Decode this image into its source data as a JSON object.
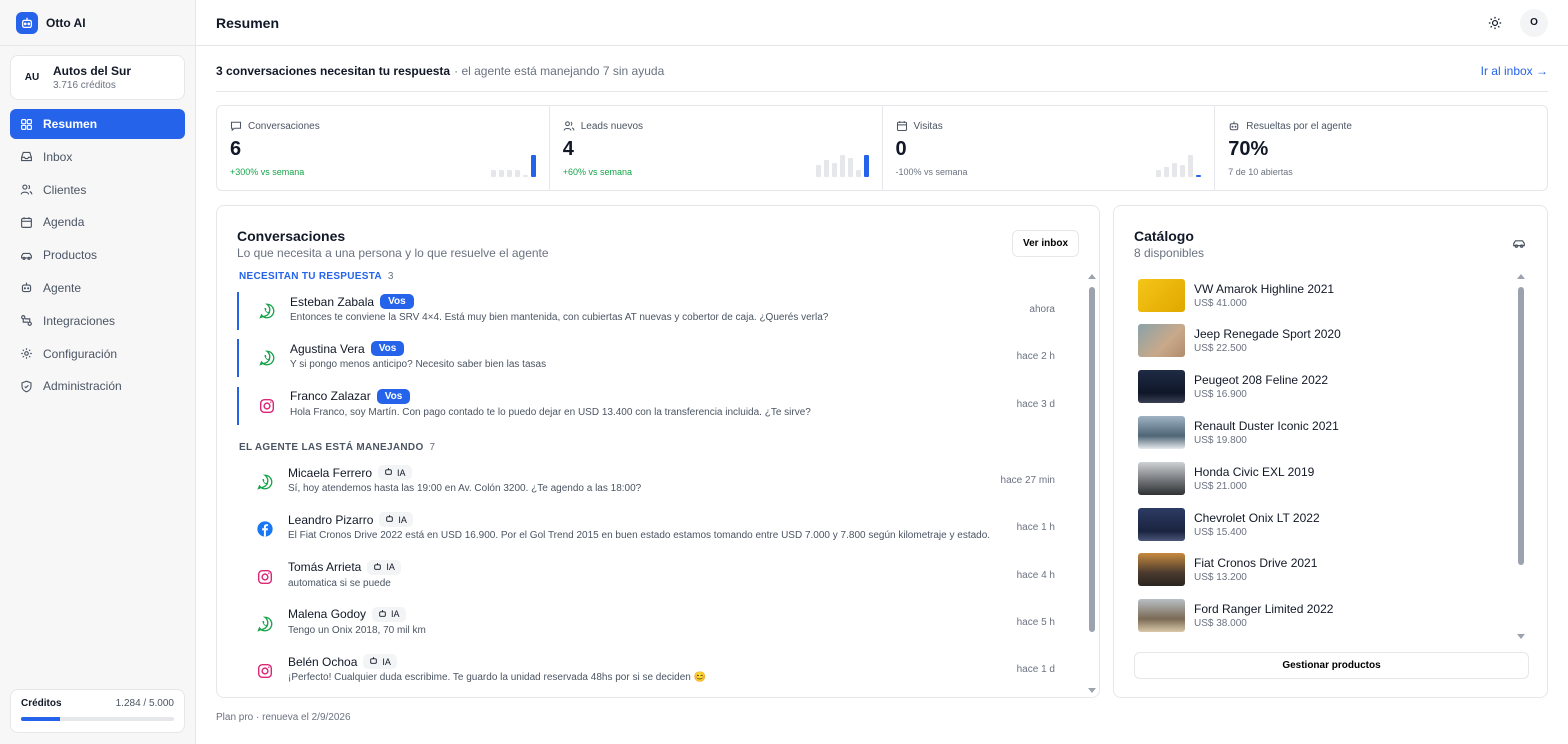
{
  "app": {
    "name": "Otto AI"
  },
  "account": {
    "initials": "AU",
    "name": "Autos del Sur",
    "credits": "3.716 créditos"
  },
  "nav": [
    {
      "label": "Resumen",
      "icon": "dashboard-icon",
      "active": true
    },
    {
      "label": "Inbox",
      "icon": "inbox-icon"
    },
    {
      "label": "Clientes",
      "icon": "users-icon"
    },
    {
      "label": "Agenda",
      "icon": "calendar-icon"
    },
    {
      "label": "Productos",
      "icon": "car-icon"
    },
    {
      "label": "Agente",
      "icon": "bot-icon"
    },
    {
      "label": "Integraciones",
      "icon": "integrations-icon"
    },
    {
      "label": "Configuración",
      "icon": "gear-icon"
    },
    {
      "label": "Administración",
      "icon": "shield-icon"
    }
  ],
  "credits_box": {
    "label": "Créditos",
    "value": "1.284 / 5.000",
    "fraction": 0.2568,
    "accent": "#2563eb"
  },
  "header": {
    "title": "Resumen",
    "theme_icon": "sun-icon",
    "user_initial": "O"
  },
  "alert": {
    "strong": "3 conversaciones necesitan tu respuesta",
    "rest": "· el agente está manejando 7 sin ayuda",
    "link": "Ir al inbox →"
  },
  "stats": [
    {
      "label": "Conversaciones",
      "icon": "chat-icon",
      "value": "6",
      "trend": "+300% vs semana",
      "trend_color": "#16a34a",
      "spark": [
        0.3,
        0.3,
        0.3,
        0.3,
        0.1,
        0.9
      ],
      "highlight_last": true
    },
    {
      "label": "Leads nuevos",
      "icon": "users-icon",
      "value": "4",
      "trend": "+60% vs semana",
      "trend_color": "#16a34a",
      "spark": [
        0.5,
        0.7,
        0.6,
        0.9,
        0.8,
        0.3,
        0.9
      ],
      "highlight_last": true
    },
    {
      "label": "Visitas",
      "icon": "calendar-icon",
      "value": "0",
      "trend": "-100% vs semana",
      "trend_color": "#6b7280",
      "spark": [
        0.3,
        0.4,
        0.6,
        0.5,
        0.9,
        0.08
      ],
      "highlight_last": true
    },
    {
      "label": "Resueltas por el agente",
      "icon": "bot-icon",
      "value": "70%",
      "trend": "7 de 10 abiertas",
      "trend_color": "#6b7280",
      "spark": [],
      "highlight_last": false
    }
  ],
  "conversations": {
    "title": "Conversaciones",
    "subtitle": "Lo que necesita a una persona y lo que resuelve el agente",
    "button": "Ver inbox",
    "needs_label": "NECESITAN TU RESPUESTA",
    "needs_count": "3",
    "agent_label": "EL AGENTE LAS ESTÁ MANEJANDO",
    "agent_count": "7",
    "needs": [
      {
        "name": "Esteban Zabala",
        "badge": "Vos",
        "channel": "whatsapp-icon",
        "message": "Entonces te conviene la SRV 4×4. Está muy bien mantenida, con cubiertas AT nuevas y cobertor de caja. ¿Querés verla?",
        "time": "ahora"
      },
      {
        "name": "Agustina Vera",
        "badge": "Vos",
        "channel": "whatsapp-icon",
        "message": "Y si pongo menos anticipo? Necesito saber bien las tasas",
        "time": "hace 2 h"
      },
      {
        "name": "Franco Zalazar",
        "badge": "Vos",
        "channel": "instagram-icon",
        "message": "Hola Franco, soy Martín. Con pago contado te lo puedo dejar en USD 13.400 con la transferencia incluida. ¿Te sirve?",
        "time": "hace 3 d"
      }
    ],
    "agent": [
      {
        "name": "Micaela Ferrero",
        "badge": "IA",
        "channel": "whatsapp-icon",
        "message": "Sí, hoy atendemos hasta las 19:00 en Av. Colón 3200. ¿Te agendo a las 18:00?",
        "time": "hace 27 min"
      },
      {
        "name": "Leandro Pizarro",
        "badge": "IA",
        "channel": "facebook-icon",
        "message": "El Fiat Cronos Drive 2022 está en USD 16.900. Por el Gol Trend 2015 en buen estado estamos tomando entre USD 7.000 y 7.800 según kilometraje y estado.",
        "time": "hace 1 h"
      },
      {
        "name": "Tomás Arrieta",
        "badge": "IA",
        "channel": "instagram-icon",
        "message": "automatica si se puede",
        "time": "hace 4 h"
      },
      {
        "name": "Malena Godoy",
        "badge": "IA",
        "channel": "whatsapp-icon",
        "message": "Tengo un Onix 2018, 70 mil km",
        "time": "hace 5 h"
      },
      {
        "name": "Belén Ochoa",
        "badge": "IA",
        "channel": "instagram-icon",
        "message": "¡Perfecto! Cualquier duda escribime. Te guardo la unidad reservada 48hs por si se deciden 😊",
        "time": "hace 1 d"
      }
    ]
  },
  "catalog": {
    "title": "Catálogo",
    "subtitle": "8 disponibles",
    "button": "Gestionar productos",
    "items": [
      {
        "name": "VW Amarok Highline 2021",
        "price": "US$ 41.000"
      },
      {
        "name": "Jeep Renegade Sport 2020",
        "price": "US$ 22.500"
      },
      {
        "name": "Peugeot 208 Feline 2022",
        "price": "US$ 16.900"
      },
      {
        "name": "Renault Duster Iconic 2021",
        "price": "US$ 19.800"
      },
      {
        "name": "Honda Civic EXL 2019",
        "price": "US$ 21.000"
      },
      {
        "name": "Chevrolet Onix LT 2022",
        "price": "US$ 15.400"
      },
      {
        "name": "Fiat Cronos Drive 2021",
        "price": "US$ 13.200"
      },
      {
        "name": "Ford Ranger Limited 2022",
        "price": "US$ 38.000"
      }
    ]
  },
  "footer": {
    "text": "Plan pro · renueva el 2/9/2026"
  }
}
